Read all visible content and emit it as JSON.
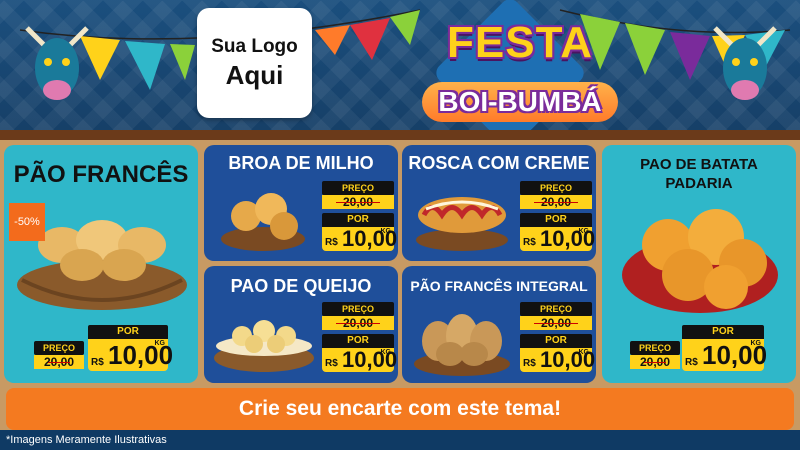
{
  "header": {
    "logo_line1": "Sua Logo",
    "logo_line2": "Aqui",
    "festa": "FESTA",
    "boi_bumba": "BOI-BUMBÁ"
  },
  "products": {
    "pao_frances": {
      "title": "PÃO FRANCÊS",
      "discount": "-50%",
      "preco_label": "PREÇO",
      "old_price": "20,00",
      "por_label": "POR",
      "currency": "R$",
      "new_price": "10,00",
      "unit": "KG"
    },
    "broa": {
      "title": "BROA DE MILHO",
      "preco_label": "PREÇO",
      "old_price": "20,00",
      "por_label": "POR",
      "currency": "R$",
      "new_price": "10,00",
      "unit": "KG"
    },
    "rosca": {
      "title": "ROSCA COM CREME",
      "preco_label": "PREÇO",
      "old_price": "20,00",
      "por_label": "POR",
      "currency": "R$",
      "new_price": "10,00",
      "unit": "KG"
    },
    "pao_batata": {
      "title_line1": "PAO DE BATATA",
      "title_line2": "PADARIA",
      "preco_label": "PREÇO",
      "old_price": "20,00",
      "por_label": "POR",
      "currency": "R$",
      "new_price": "10,00",
      "unit": "KG"
    },
    "queijo": {
      "title": "PAO DE QUEIJO",
      "preco_label": "PREÇO",
      "old_price": "20,00",
      "por_label": "POR",
      "currency": "R$",
      "new_price": "10,00",
      "unit": "KG"
    },
    "integral": {
      "title": "PÃO FRANCÊS INTEGRAL",
      "preco_label": "PREÇO",
      "old_price": "20,00",
      "por_label": "POR",
      "currency": "R$",
      "new_price": "10,00",
      "unit": "KG"
    }
  },
  "cta": "Crie seu encarte com este tema!",
  "footnote": "*Imagens Meramente Ilustrativas",
  "colors": {
    "header_blue": "#1b4f7e",
    "teal": "#2fb7c9",
    "card_blue": "#1f4f9a",
    "price_yellow": "#ffd21a",
    "orange": "#f47a20"
  }
}
